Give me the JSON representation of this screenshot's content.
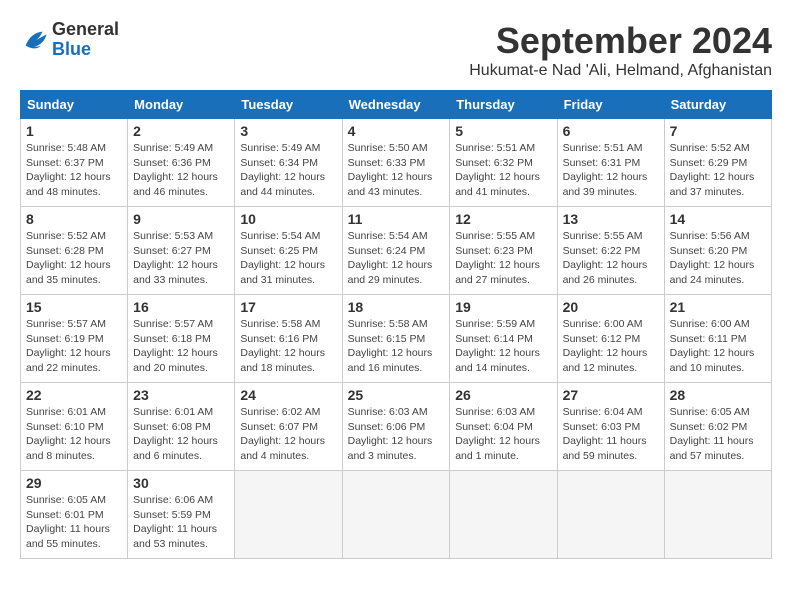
{
  "logo": {
    "general": "General",
    "blue": "Blue"
  },
  "title": "September 2024",
  "subtitle": "Hukumat-e Nad 'Ali, Helmand, Afghanistan",
  "days_header": [
    "Sunday",
    "Monday",
    "Tuesday",
    "Wednesday",
    "Thursday",
    "Friday",
    "Saturday"
  ],
  "weeks": [
    [
      {
        "day": "1",
        "info": "Sunrise: 5:48 AM\nSunset: 6:37 PM\nDaylight: 12 hours\nand 48 minutes."
      },
      {
        "day": "2",
        "info": "Sunrise: 5:49 AM\nSunset: 6:36 PM\nDaylight: 12 hours\nand 46 minutes."
      },
      {
        "day": "3",
        "info": "Sunrise: 5:49 AM\nSunset: 6:34 PM\nDaylight: 12 hours\nand 44 minutes."
      },
      {
        "day": "4",
        "info": "Sunrise: 5:50 AM\nSunset: 6:33 PM\nDaylight: 12 hours\nand 43 minutes."
      },
      {
        "day": "5",
        "info": "Sunrise: 5:51 AM\nSunset: 6:32 PM\nDaylight: 12 hours\nand 41 minutes."
      },
      {
        "day": "6",
        "info": "Sunrise: 5:51 AM\nSunset: 6:31 PM\nDaylight: 12 hours\nand 39 minutes."
      },
      {
        "day": "7",
        "info": "Sunrise: 5:52 AM\nSunset: 6:29 PM\nDaylight: 12 hours\nand 37 minutes."
      }
    ],
    [
      {
        "day": "8",
        "info": "Sunrise: 5:52 AM\nSunset: 6:28 PM\nDaylight: 12 hours\nand 35 minutes."
      },
      {
        "day": "9",
        "info": "Sunrise: 5:53 AM\nSunset: 6:27 PM\nDaylight: 12 hours\nand 33 minutes."
      },
      {
        "day": "10",
        "info": "Sunrise: 5:54 AM\nSunset: 6:25 PM\nDaylight: 12 hours\nand 31 minutes."
      },
      {
        "day": "11",
        "info": "Sunrise: 5:54 AM\nSunset: 6:24 PM\nDaylight: 12 hours\nand 29 minutes."
      },
      {
        "day": "12",
        "info": "Sunrise: 5:55 AM\nSunset: 6:23 PM\nDaylight: 12 hours\nand 27 minutes."
      },
      {
        "day": "13",
        "info": "Sunrise: 5:55 AM\nSunset: 6:22 PM\nDaylight: 12 hours\nand 26 minutes."
      },
      {
        "day": "14",
        "info": "Sunrise: 5:56 AM\nSunset: 6:20 PM\nDaylight: 12 hours\nand 24 minutes."
      }
    ],
    [
      {
        "day": "15",
        "info": "Sunrise: 5:57 AM\nSunset: 6:19 PM\nDaylight: 12 hours\nand 22 minutes."
      },
      {
        "day": "16",
        "info": "Sunrise: 5:57 AM\nSunset: 6:18 PM\nDaylight: 12 hours\nand 20 minutes."
      },
      {
        "day": "17",
        "info": "Sunrise: 5:58 AM\nSunset: 6:16 PM\nDaylight: 12 hours\nand 18 minutes."
      },
      {
        "day": "18",
        "info": "Sunrise: 5:58 AM\nSunset: 6:15 PM\nDaylight: 12 hours\nand 16 minutes."
      },
      {
        "day": "19",
        "info": "Sunrise: 5:59 AM\nSunset: 6:14 PM\nDaylight: 12 hours\nand 14 minutes."
      },
      {
        "day": "20",
        "info": "Sunrise: 6:00 AM\nSunset: 6:12 PM\nDaylight: 12 hours\nand 12 minutes."
      },
      {
        "day": "21",
        "info": "Sunrise: 6:00 AM\nSunset: 6:11 PM\nDaylight: 12 hours\nand 10 minutes."
      }
    ],
    [
      {
        "day": "22",
        "info": "Sunrise: 6:01 AM\nSunset: 6:10 PM\nDaylight: 12 hours\nand 8 minutes."
      },
      {
        "day": "23",
        "info": "Sunrise: 6:01 AM\nSunset: 6:08 PM\nDaylight: 12 hours\nand 6 minutes."
      },
      {
        "day": "24",
        "info": "Sunrise: 6:02 AM\nSunset: 6:07 PM\nDaylight: 12 hours\nand 4 minutes."
      },
      {
        "day": "25",
        "info": "Sunrise: 6:03 AM\nSunset: 6:06 PM\nDaylight: 12 hours\nand 3 minutes."
      },
      {
        "day": "26",
        "info": "Sunrise: 6:03 AM\nSunset: 6:04 PM\nDaylight: 12 hours\nand 1 minute."
      },
      {
        "day": "27",
        "info": "Sunrise: 6:04 AM\nSunset: 6:03 PM\nDaylight: 11 hours\nand 59 minutes."
      },
      {
        "day": "28",
        "info": "Sunrise: 6:05 AM\nSunset: 6:02 PM\nDaylight: 11 hours\nand 57 minutes."
      }
    ],
    [
      {
        "day": "29",
        "info": "Sunrise: 6:05 AM\nSunset: 6:01 PM\nDaylight: 11 hours\nand 55 minutes."
      },
      {
        "day": "30",
        "info": "Sunrise: 6:06 AM\nSunset: 5:59 PM\nDaylight: 11 hours\nand 53 minutes."
      },
      {
        "day": "",
        "info": ""
      },
      {
        "day": "",
        "info": ""
      },
      {
        "day": "",
        "info": ""
      },
      {
        "day": "",
        "info": ""
      },
      {
        "day": "",
        "info": ""
      }
    ]
  ]
}
